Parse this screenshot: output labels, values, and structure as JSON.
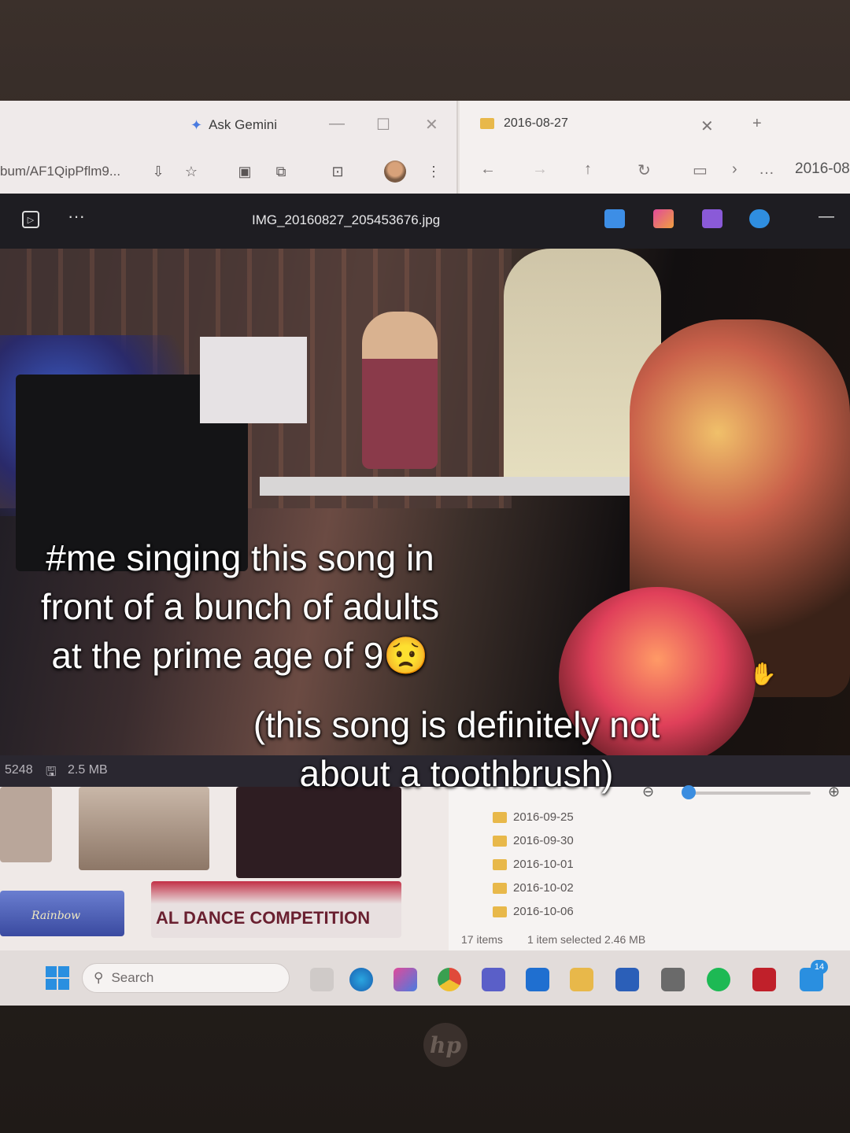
{
  "browser": {
    "gemini_label": "Ask Gemini",
    "url_fragment": "bum/AF1QipPflm9..."
  },
  "explorer": {
    "tab_title": "2016-08-27",
    "path_fragment": "2016-08",
    "folders": [
      "2016-09-25",
      "2016-09-30",
      "2016-10-01",
      "2016-10-02",
      "2016-10-06"
    ],
    "items_count": "17 items",
    "selection_info": "1 item selected  2.46 MB"
  },
  "viewer": {
    "file_name": "IMG_20160827_205453676.jpg",
    "dimension_fragment": "5248",
    "file_size": "2.5 MB"
  },
  "gallery": {
    "banner_text": "AL DANCE COMPETITION",
    "sign_text": "Rainbow"
  },
  "taskbar": {
    "search_placeholder": "Search",
    "notification_count": "14"
  },
  "overlay": {
    "caption_line1": "#me singing this song in",
    "caption_line2": "front of a bunch of adults",
    "caption_line3": "at the prime age of 9😟",
    "subcaption_line1": "(this song is definitely not",
    "subcaption_line2": "about a toothbrush)"
  },
  "colors": {
    "accent": "#2a8fe0",
    "viewer_bg": "#1e1d22",
    "folder": "#e8b84a"
  }
}
